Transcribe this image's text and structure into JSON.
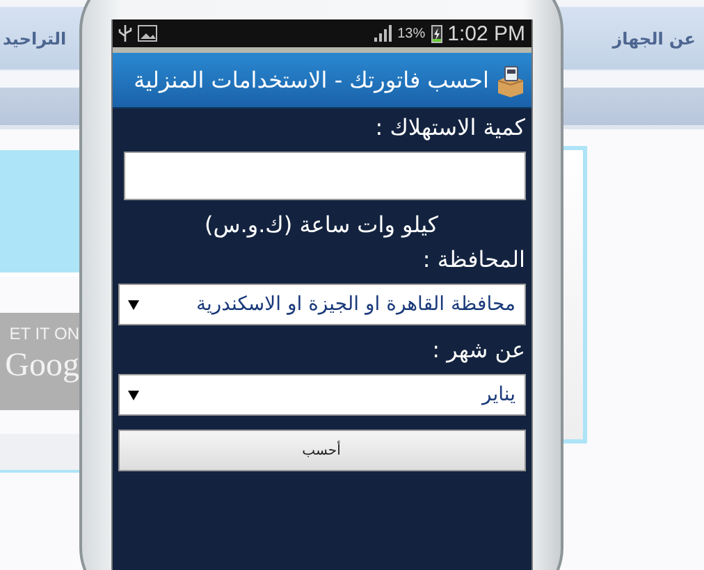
{
  "background_page": {
    "nav_items": [
      "عن الجهاز",
      "التراحيد"
    ],
    "store_badge": {
      "line_1": "ET IT ON",
      "line_2": "Goog"
    }
  },
  "status_bar": {
    "battery": "13%",
    "time": "1:02 PM"
  },
  "app": {
    "title": "احسب فاتورتك - الاستخدامات المنزلية",
    "consumption": {
      "label": "كمية الاستهلاك :",
      "unit": "كيلو وات ساعة (ك.و.س)"
    },
    "governorate": {
      "label": "المحافظة :",
      "value": "محافظة القاهرة او الجيزة او الاسكندرية"
    },
    "month": {
      "label": "عن شهر :",
      "value": "يناير"
    },
    "calculate_button": "أحسب"
  }
}
